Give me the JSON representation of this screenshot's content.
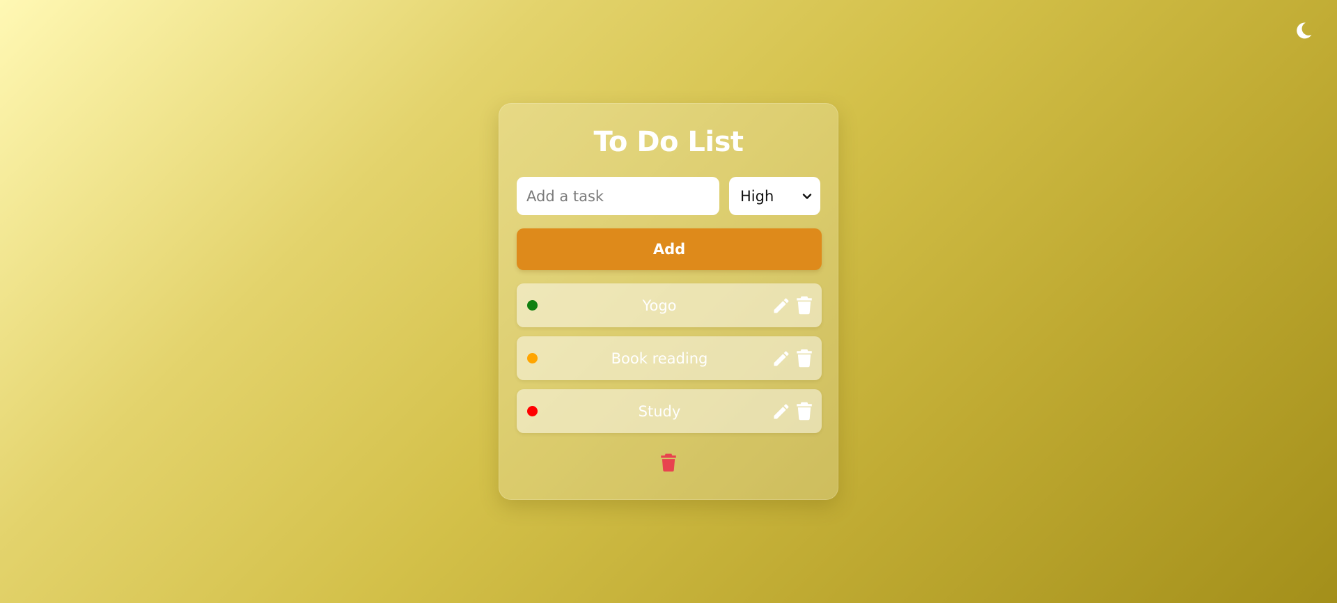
{
  "app": {
    "title": "To Do List",
    "theme_toggle_icon": "moon-icon"
  },
  "form": {
    "task_input_placeholder": "Add a task",
    "task_input_value": "",
    "priority_selected": "High",
    "add_label": "Add"
  },
  "colors": {
    "accent": "#de8a1b",
    "priority_low": "#118011",
    "priority_medium": "#ffa500",
    "priority_high": "#ff0000",
    "clear_all": "#e8434f"
  },
  "tasks": [
    {
      "text": "Yogo",
      "priority_color": "#118011",
      "edit_icon": "pencil-icon",
      "delete_icon": "trash-icon"
    },
    {
      "text": "Book reading",
      "priority_color": "#ffa500",
      "edit_icon": "pencil-icon",
      "delete_icon": "trash-icon"
    },
    {
      "text": "Study",
      "priority_color": "#ff0000",
      "edit_icon": "pencil-icon",
      "delete_icon": "trash-icon"
    }
  ],
  "footer": {
    "clear_all_icon": "trash-icon"
  }
}
